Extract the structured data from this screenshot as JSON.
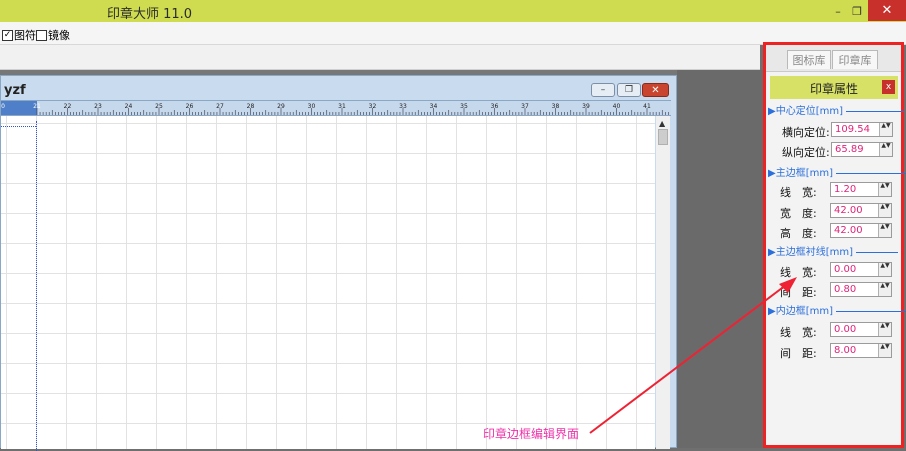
{
  "window": {
    "title": "印章大师 11.0",
    "minimize": "–",
    "restore": "❐",
    "close": "✕"
  },
  "toolbar": {
    "checkbox_glyph_checked": "✓",
    "glyph_label": "图符",
    "mirror_label": "镜像"
  },
  "document": {
    "title": "yzf",
    "minimize": "–",
    "restore": "❐",
    "close": "✕",
    "ruler_ticks": [
      "0",
      "21",
      "22",
      "23",
      "24",
      "25",
      "26",
      "27",
      "28",
      "29",
      "30",
      "31",
      "32",
      "33",
      "34",
      "35",
      "36",
      "37",
      "38",
      "39",
      "40",
      "41",
      "42"
    ]
  },
  "side_panel": {
    "tabs": [
      "图标库",
      "印章库"
    ],
    "title": "印章属性",
    "close": "x",
    "sections": [
      {
        "header": "▶中心定位[mm]",
        "fields": [
          {
            "label": "横向定位:",
            "value": "109.54"
          },
          {
            "label": "纵向定位:",
            "value": "65.89"
          }
        ]
      },
      {
        "header": "▶主边框[mm]",
        "fields": [
          {
            "label": "线　宽:",
            "value": "1.20"
          },
          {
            "label": "宽　度:",
            "value": "42.00"
          },
          {
            "label": "高　度:",
            "value": "42.00"
          }
        ]
      },
      {
        "header": "▶主边框衬线[mm]",
        "fields": [
          {
            "label": "线　宽:",
            "value": "0.00"
          },
          {
            "label": "间　距:",
            "value": "0.80"
          }
        ]
      },
      {
        "header": "▶内边框[mm]",
        "fields": [
          {
            "label": "线　宽:",
            "value": "0.00"
          },
          {
            "label": "间　距:",
            "value": "8.00"
          }
        ]
      }
    ]
  },
  "annotation": {
    "text": "印章边框编辑界面"
  },
  "colors": {
    "title_bar": "#cfdc4f",
    "highlight_border": "#ee2222",
    "annotation": "#ee33aa",
    "value_text": "#e0247a",
    "section_text": "#2a6fdb"
  }
}
